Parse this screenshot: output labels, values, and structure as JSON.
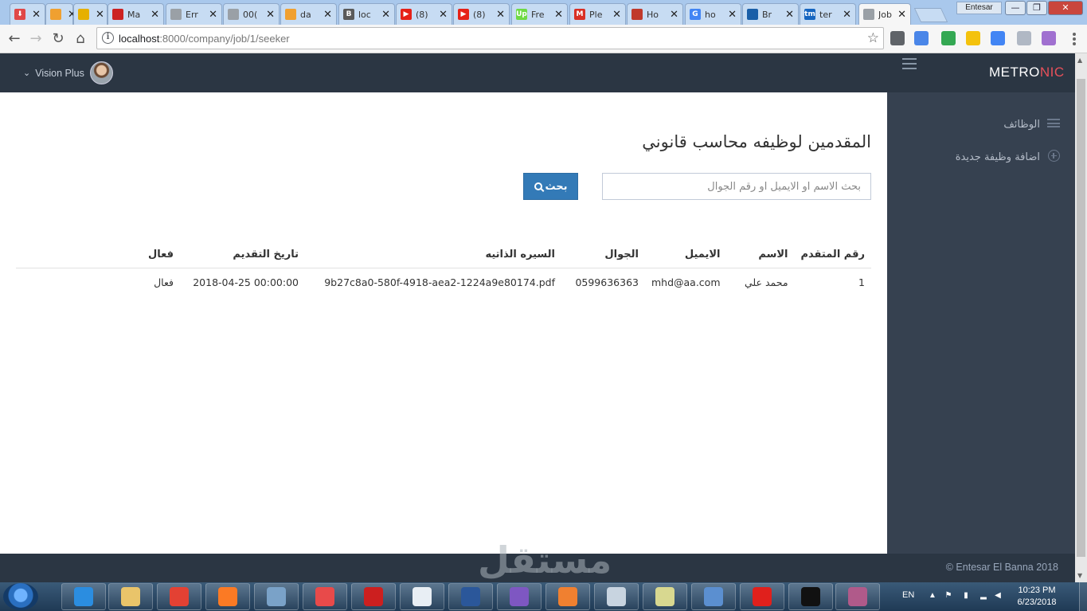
{
  "browser": {
    "tabs": [
      {
        "label": "",
        "fav_color": "#e04848",
        "fav_glyph": "⬇",
        "active": false
      },
      {
        "label": "",
        "fav_color": "#f0a030",
        "fav_glyph": "",
        "active": false
      },
      {
        "label": "",
        "fav_color": "#e6b000",
        "fav_glyph": "",
        "active": false
      },
      {
        "label": "Ma",
        "fav_color": "#cc2222",
        "fav_glyph": "",
        "active": false
      },
      {
        "label": "Err",
        "fav_color": "#9aa0a6",
        "fav_glyph": "",
        "active": false
      },
      {
        "label": "00(",
        "fav_color": "#9aa0a6",
        "fav_glyph": "",
        "active": false
      },
      {
        "label": "da",
        "fav_color": "#f0a030",
        "fav_glyph": "",
        "active": false
      },
      {
        "label": "loc",
        "fav_color": "#5a5a5a",
        "fav_glyph": "B",
        "active": false
      },
      {
        "label": "(8)",
        "fav_color": "#e62117",
        "fav_glyph": "▶",
        "active": false
      },
      {
        "label": "(8)",
        "fav_color": "#e62117",
        "fav_glyph": "▶",
        "active": false
      },
      {
        "label": "Fre",
        "fav_color": "#6fda44",
        "fav_glyph": "Up",
        "active": false
      },
      {
        "label": "Ple",
        "fav_color": "#d93025",
        "fav_glyph": "M",
        "active": false
      },
      {
        "label": "Ho",
        "fav_color": "#c0392b",
        "fav_glyph": "",
        "active": false
      },
      {
        "label": "ho",
        "fav_color": "#4285f4",
        "fav_glyph": "G",
        "active": false
      },
      {
        "label": "Br",
        "fav_color": "#1a5fa8",
        "fav_glyph": "",
        "active": false
      },
      {
        "label": "ter",
        "fav_color": "#1565c0",
        "fav_glyph": "tm",
        "active": false
      },
      {
        "label": "Job",
        "fav_color": "#9aa0a6",
        "fav_glyph": "",
        "active": true
      }
    ],
    "user_chip": "Entesar",
    "window_controls": {
      "minimize": "—",
      "maximize": "❐",
      "close": "✕"
    },
    "url_host": "localhost",
    "url_path": ":8000/company/job/1/seeker"
  },
  "header": {
    "logo_main": "METRO",
    "logo_accent": "NIC",
    "user_name": "Vision Plus"
  },
  "sidebar": {
    "items": [
      {
        "label": "الوظائف",
        "icon": "list-icon"
      },
      {
        "label": "اضافة وظيفة جديدة",
        "icon": "plus-circle-icon"
      }
    ]
  },
  "main": {
    "title": "المقدمين لوظيفه محاسب قانوني",
    "search_placeholder": "بحث الاسم او الايميل او رقم الجوال",
    "search_button": "بحث",
    "table": {
      "columns": [
        "رقم المتقدم",
        "الاسم",
        "الايميل",
        "الجوال",
        "السيره الذاتيه",
        "تاريخ التقديم",
        "فعال"
      ],
      "rows": [
        [
          "1",
          "محمد علي",
          "mhd@aa.com",
          "0599636363",
          "9b27c8a0-580f-4918-aea2-1224a9e80174.pdf",
          "2018-04-25 00:00:00",
          "فعال"
        ]
      ]
    }
  },
  "footer": {
    "copyright": "© Entesar El Banna 2018",
    "watermark": "مستقل"
  },
  "taskbar": {
    "apps": [
      {
        "name": "internet-explorer",
        "color": "#2b8de0"
      },
      {
        "name": "file-explorer",
        "color": "#e9c46a"
      },
      {
        "name": "chrome",
        "color": "#e34133"
      },
      {
        "name": "xampp",
        "color": "#fb7a24"
      },
      {
        "name": "jc",
        "color": "#7aa2c8"
      },
      {
        "name": "photo-app",
        "color": "#e84a4a"
      },
      {
        "name": "acrobat",
        "color": "#cc1f1f"
      },
      {
        "name": "terminal-app",
        "color": "#e8eef4"
      },
      {
        "name": "word",
        "color": "#2b579a"
      },
      {
        "name": "video-app",
        "color": "#7e57c2"
      },
      {
        "name": "tool-app",
        "color": "#f08030"
      },
      {
        "name": "snipping-tool",
        "color": "#c8d4e0"
      },
      {
        "name": "chart-app",
        "color": "#d8d890"
      },
      {
        "name": "control-panel",
        "color": "#5b8fd0"
      },
      {
        "name": "opera",
        "color": "#e0201c"
      },
      {
        "name": "cmd",
        "color": "#111111"
      },
      {
        "name": "winrar",
        "color": "#b05a8a"
      }
    ],
    "language": "EN",
    "time": "10:23 PM",
    "date": "6/23/2018"
  }
}
